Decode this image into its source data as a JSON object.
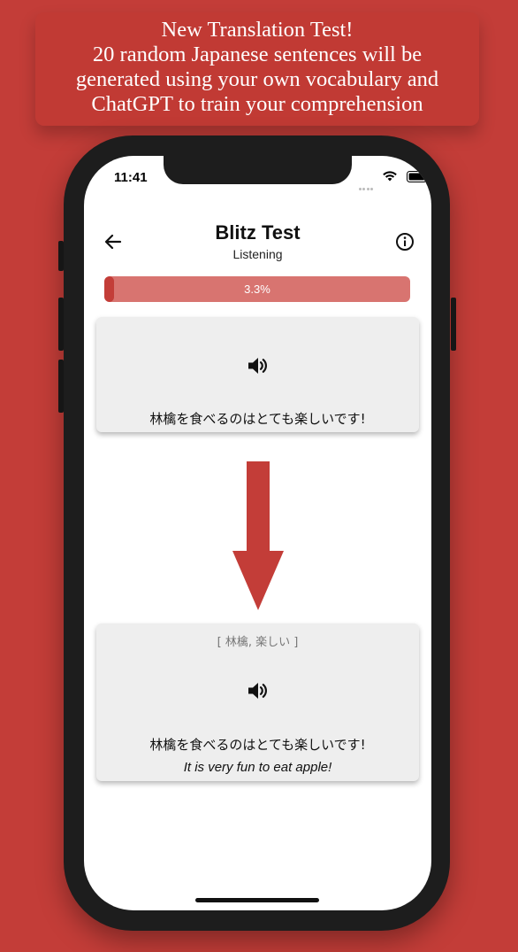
{
  "banner": {
    "text": "New Translation Test!\n20 random Japanese sentences will be\ngenerated using your own vocabulary and\nChatGPT to train your comprehension"
  },
  "status_bar": {
    "time": "11:41"
  },
  "header": {
    "title": "Blitz Test",
    "subtitle": "Listening",
    "back_icon": "arrow-left-icon",
    "info_icon": "info-circle-icon"
  },
  "progress": {
    "label": "3.3%",
    "value": 0.033
  },
  "question_card": {
    "speaker_icon": "speaker-icon",
    "sentence": "林檎を食べるのはとても楽しいです!"
  },
  "answer_card": {
    "vocab": "[ 林檎, 楽しい ]",
    "speaker_icon": "speaker-icon",
    "sentence": "林檎を食べるのはとても楽しいです!",
    "translation": "It is very fun to eat apple!"
  },
  "colors": {
    "background": "#c33d38",
    "accent": "#c33d38",
    "progress_track": "#d87470",
    "card": "#eeeeee"
  }
}
